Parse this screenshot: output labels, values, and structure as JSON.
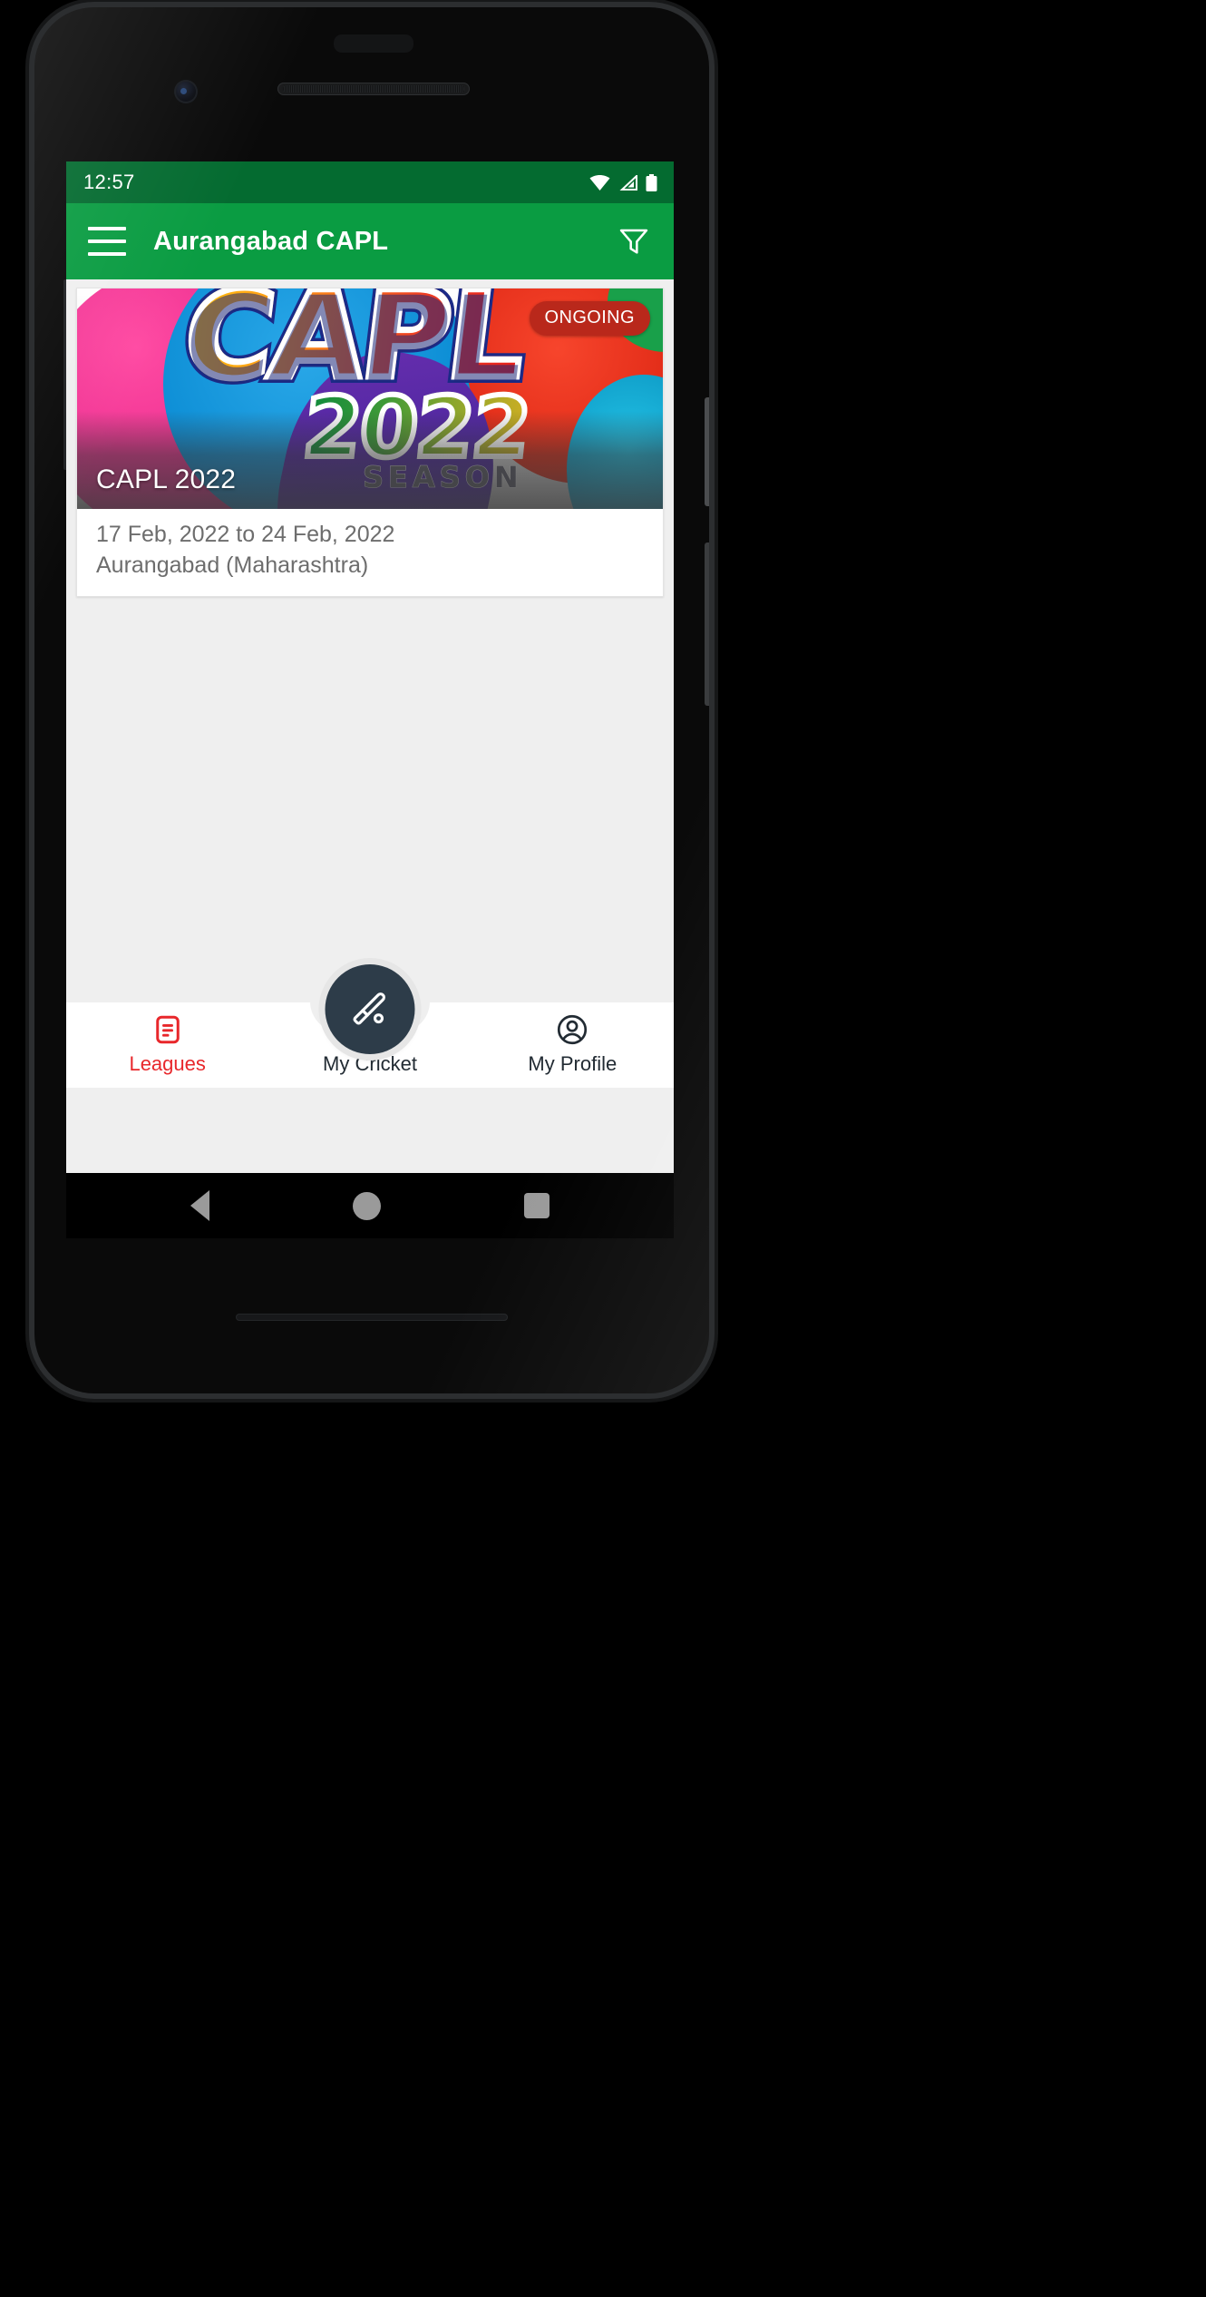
{
  "status_bar": {
    "time": "12:57",
    "icons": [
      "wifi-icon",
      "cellular-signal-icon",
      "battery-icon"
    ]
  },
  "app_bar": {
    "menu_icon": "hamburger-menu-icon",
    "title": "Aurangabad CAPL",
    "filter_icon": "filter-funnel-icon"
  },
  "league_card": {
    "badge": "ONGOING",
    "banner_title": "CAPL 2022",
    "dates": "17 Feb, 2022  to 24 Feb, 2022",
    "location": "Aurangabad (Maharashtra)",
    "banner_art": {
      "word_main": "CAPL",
      "word_year": "2022",
      "word_season": "SEASON"
    }
  },
  "bottom_nav": {
    "items": [
      {
        "label": "Leagues",
        "icon": "league-list-icon",
        "active": true
      },
      {
        "label": "My Cricket",
        "icon": "cricket-bat-icon",
        "active": false
      },
      {
        "label": "My Profile",
        "icon": "user-circle-icon",
        "active": false
      }
    ]
  },
  "android_nav": {
    "back": "back-triangle-icon",
    "home": "home-circle-icon",
    "recents": "recents-square-icon"
  },
  "colors": {
    "status_bar_green": "#046b30",
    "app_bar_green": "#0a9c42",
    "badge_red": "#b9281b",
    "active_nav_red": "#e8272b",
    "fab_navy": "#2d3c49",
    "page_bg": "#efefef"
  }
}
